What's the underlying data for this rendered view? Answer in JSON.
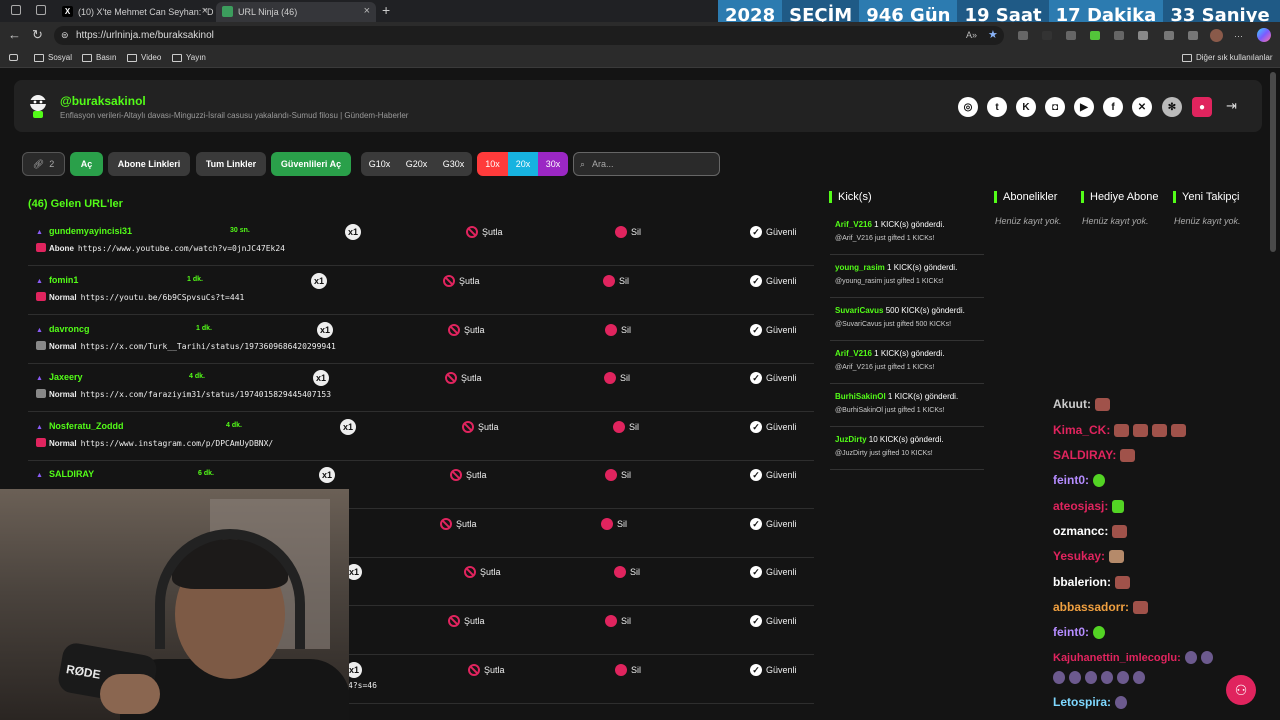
{
  "tabs": [
    {
      "label": "(10) X'te Mehmet Can Seyhan: \"D",
      "icon": "x-logo-icon"
    },
    {
      "label": "URL Ninja (46)",
      "icon": "urlninja-icon"
    }
  ],
  "countdown": {
    "year": "2028",
    "label": "SEÇİM",
    "days": "946 Gün",
    "hours": "19 Saat",
    "minutes": "17 Dakika",
    "seconds": "33 Saniye"
  },
  "address": {
    "url": "https://urlninja.me/buraksakinol"
  },
  "bookmarks": [
    "Sosyal",
    "Basın",
    "Video",
    "Yayın"
  ],
  "bookmarks_other": "Diğer sık kullanılanlar",
  "profile": {
    "username": "@buraksakinol",
    "subtitle": "Enflasyon verileri-Altaylı davası-Minguzzi-İsrail casusu yakalandı-Sumud filosu | Gündem-Haberler"
  },
  "toolbar": {
    "link_count": "2",
    "ac": "Aç",
    "abone": "Abone Linkleri",
    "tum": "Tum Linkler",
    "guvenli": "Güvenlileri Aç",
    "g10": "G10x",
    "g20": "G20x",
    "g30": "G30x",
    "m10": "10x",
    "m20": "20x",
    "m30": "30x",
    "search_placeholder": "Ara..."
  },
  "urls_title": "(46) Gelen URL'ler",
  "actions": {
    "ban": "Şutla",
    "delete": "Sil",
    "safe": "Güvenli"
  },
  "rows": [
    {
      "user": "gundemyayincisi31",
      "time": "30 sn.",
      "count": "x1",
      "level": "Abone",
      "src": "youtube",
      "link": "https://www.youtube.com/watch?v=0jnJC47Ek24"
    },
    {
      "user": "fomin1",
      "time": "1 dk.",
      "count": "x1",
      "level": "Normal",
      "src": "youtube",
      "link": "https://youtu.be/6b9CSpvsuCs?t=441"
    },
    {
      "user": "davroncg",
      "time": "1 dk.",
      "count": "x1",
      "level": "Normal",
      "src": "x",
      "link": "https://x.com/Turk__Tarihi/status/1973609686420299941"
    },
    {
      "user": "Jaxeery",
      "time": "4 dk.",
      "count": "x1",
      "level": "Normal",
      "src": "x",
      "link": "https://x.com/faraziyim31/status/1974015829445407153"
    },
    {
      "user": "Nosferatu_Zoddd",
      "time": "4 dk.",
      "count": "x1",
      "level": "Normal",
      "src": "instagram",
      "link": "https://www.instagram.com/p/DPCAmUyDBNX/"
    },
    {
      "user": "SALDIRAY",
      "time": "6 dk.",
      "count": "x1",
      "level": "",
      "src": "",
      "link": ""
    },
    {
      "user": "",
      "time": "",
      "count": "",
      "level": "",
      "src": "",
      "link": ""
    },
    {
      "user": "",
      "time": "",
      "count": "x1",
      "level": "",
      "src": "",
      "link": ""
    },
    {
      "user": "",
      "time": "",
      "count": "",
      "level": "",
      "src": "",
      "link": ""
    },
    {
      "user": "",
      "time": "",
      "count": "x1",
      "level": "",
      "src": "",
      "link": "4?s=46"
    }
  ],
  "columns": {
    "kick": "Kick(s)",
    "abone": "Abonelikler",
    "hediye": "Hediye Abone",
    "takipci": "Yeni Takipçi",
    "empty": "Henüz kayıt yok."
  },
  "kicks": [
    {
      "user": "Arif_V216",
      "text": "1 KICK(s) gönderdi.",
      "sub": "@Arif_V216 just gifted 1 KICKs!"
    },
    {
      "user": "young_rasim",
      "text": "1 KICK(s) gönderdi.",
      "sub": "@young_rasim just gifted 1 KICKs!"
    },
    {
      "user": "SuvariCavus",
      "text": "500 KICK(s) gönderdi.",
      "sub": "@SuvariCavus just gifted 500 KICKs!"
    },
    {
      "user": "Arif_V216",
      "text": "1 KICK(s) gönderdi.",
      "sub": "@Arif_V216 just gifted 1 KICKs!"
    },
    {
      "user": "BurhiSakinOl",
      "text": "1 KICK(s) gönderdi.",
      "sub": "@BurhiSakinOl just gifted 1 KICKs!"
    },
    {
      "user": "JuzDirty",
      "text": "10 KICK(s) gönderdi.",
      "sub": "@JuzDirty just gifted 10 KICKs!"
    }
  ],
  "chat": [
    {
      "name": "Akuut:",
      "color": "#8ab4f8"
    },
    {
      "name": "Kima_CK:",
      "color": "#e0245e"
    },
    {
      "name": "SALDIRAY:",
      "color": "#e0245e"
    },
    {
      "name": "feint0:",
      "color": "#b58cff"
    },
    {
      "name": "ateosjasj:",
      "color": "#e0245e"
    },
    {
      "name": "ozmancc:",
      "color": "#ffffff"
    },
    {
      "name": "Yesukay:",
      "color": "#e0245e"
    },
    {
      "name": "bbalerion:",
      "color": "#ffffff"
    },
    {
      "name": "abbassadorr:",
      "color": "#f0a040"
    },
    {
      "name": "feint0:",
      "color": "#b58cff"
    },
    {
      "name": "Kajuhanettin_imlecoglu:",
      "color": "#e0245e"
    },
    {
      "name": "Letospira:",
      "color": "#7fd8ff"
    }
  ],
  "webcam_label": "RØDE",
  "colors": {
    "kick_green": "#53fc18",
    "red": "#e0245e"
  }
}
